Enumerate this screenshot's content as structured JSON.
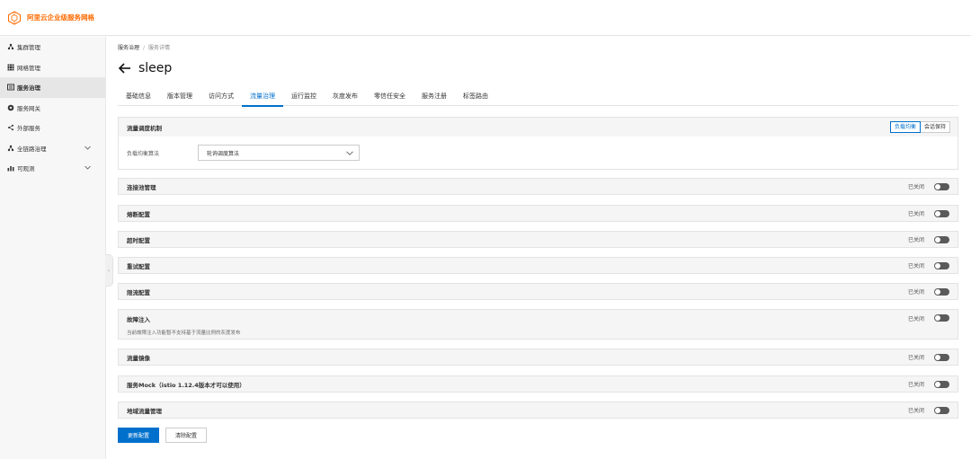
{
  "app": {
    "logo_text": "阿里云企业级服务网格",
    "brand_color": "#ff6a00"
  },
  "sidebar": {
    "items": [
      {
        "label": "集群管理",
        "icon": "cluster-icon"
      },
      {
        "label": "网格管理",
        "icon": "grid-icon"
      },
      {
        "label": "服务治理",
        "icon": "service-governance-icon",
        "active": true
      },
      {
        "label": "服务网关",
        "icon": "gateway-icon"
      },
      {
        "label": "外部服务",
        "icon": "share-icon"
      },
      {
        "label": "全链路治理",
        "icon": "link-icon",
        "expandable": true
      },
      {
        "label": "可观测",
        "icon": "chart-icon",
        "expandable": true
      }
    ]
  },
  "breadcrumb": {
    "root": "服务治理",
    "separator": "/",
    "current": "服务详情"
  },
  "page": {
    "title": "sleep",
    "accent_color": "#0070cc"
  },
  "tabs": [
    {
      "label": "基础信息"
    },
    {
      "label": "版本管理"
    },
    {
      "label": "访问方式"
    },
    {
      "label": "流量治理",
      "active": true
    },
    {
      "label": "运行监控"
    },
    {
      "label": "灰度发布"
    },
    {
      "label": "零信任安全"
    },
    {
      "label": "服务注册"
    },
    {
      "label": "标签路由"
    }
  ],
  "dispatch": {
    "title": "流量调度机制",
    "mode_load_balance": "负载均衡",
    "mode_session": "会话保持",
    "algo_label": "负载均衡算法",
    "algo_value": "轮询调度算法"
  },
  "sections": [
    {
      "label": "连接池管理",
      "status": "已关闭"
    },
    {
      "label": "熔断配置",
      "status": "已关闭"
    },
    {
      "label": "超时配置",
      "status": "已关闭"
    },
    {
      "label": "重试配置",
      "status": "已关闭"
    },
    {
      "label": "限流配置",
      "status": "已关闭"
    },
    {
      "label": "故障注入",
      "status": "已关闭",
      "desc": "当前故障注入功能暂不支持基于流量比例的灰度发布"
    },
    {
      "label": "流量镜像",
      "status": "已关闭"
    },
    {
      "label": "服务Mock（istio 1.12.4版本才可以使用）",
      "status": "已关闭"
    },
    {
      "label": "地域流量管理",
      "status": "已关闭"
    }
  ],
  "actions": {
    "update_label": "更新配置",
    "clear_label": "清除配置"
  }
}
